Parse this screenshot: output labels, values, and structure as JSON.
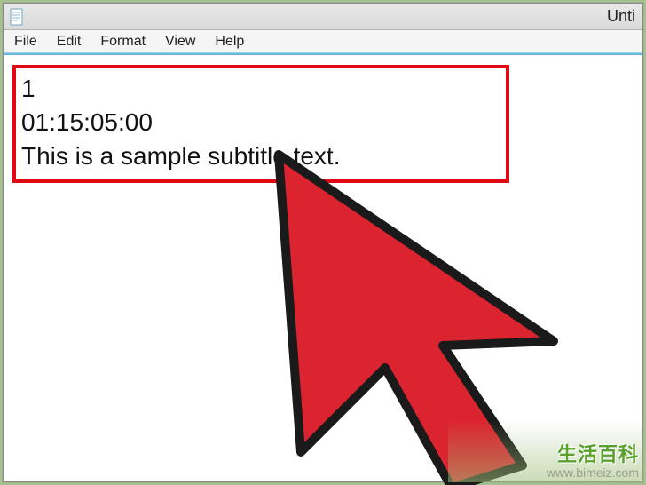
{
  "window": {
    "title_right": "Unti"
  },
  "menubar": {
    "file": "File",
    "edit": "Edit",
    "format": "Format",
    "view": "View",
    "help": "Help"
  },
  "subtitle": {
    "index": "1",
    "timecode": "01:15:05:00",
    "text": "This is a sample subtitle text."
  },
  "watermark": {
    "brand": "生活百科",
    "url": "www.bimeiz.com"
  },
  "colors": {
    "highlight_border": "#e30613",
    "cursor_fill": "#dc2430",
    "cursor_stroke": "#1a1a1a",
    "frame_bg": "#a6c191"
  }
}
